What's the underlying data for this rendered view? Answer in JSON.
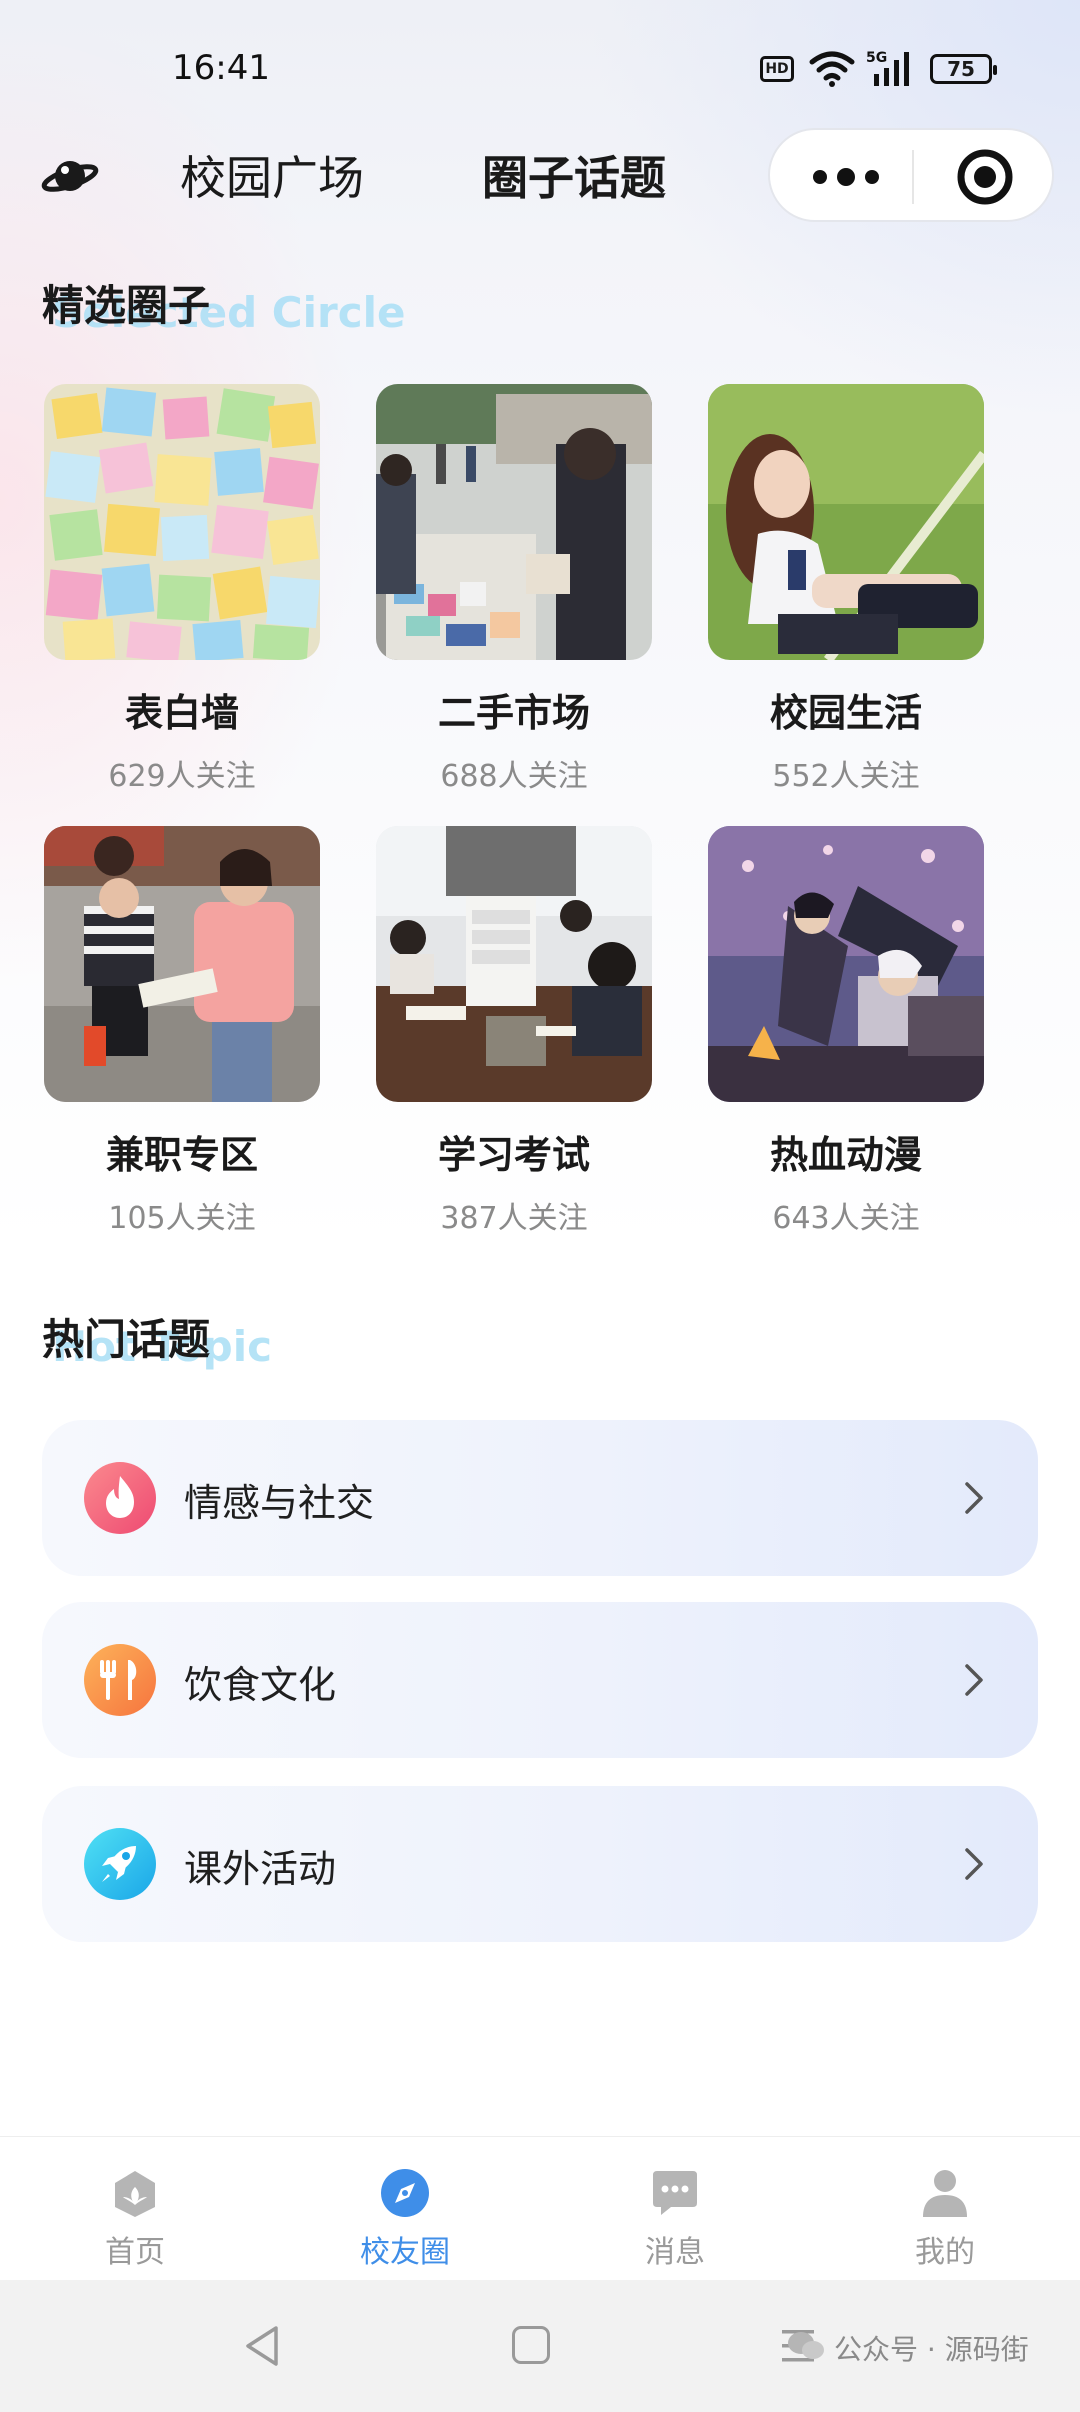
{
  "status_bar": {
    "time": "16:41",
    "hd": "HD",
    "network": "5G",
    "battery": "75"
  },
  "header": {
    "tabs": [
      {
        "label": "校园广场",
        "active": false
      },
      {
        "label": "圈子话题",
        "active": true
      }
    ],
    "capsule_icons": [
      "more-dots-icon",
      "target-icon"
    ]
  },
  "selected": {
    "title": "精选圈子",
    "subtitle": "Selected Circle",
    "items": [
      {
        "name": "表白墙",
        "followers": "629人关注"
      },
      {
        "name": "二手市场",
        "followers": "688人关注"
      },
      {
        "name": "校园生活",
        "followers": "552人关注"
      },
      {
        "name": "兼职专区",
        "followers": "105人关注"
      },
      {
        "name": "学习考试",
        "followers": "387人关注"
      },
      {
        "name": "热血动漫",
        "followers": "643人关注"
      }
    ]
  },
  "hot": {
    "title": "热门话题",
    "subtitle": "Hot Topic",
    "items": [
      {
        "label": "情感与社交",
        "icon": "flame-icon",
        "color": "#f0647f"
      },
      {
        "label": "饮食文化",
        "icon": "cutlery-icon",
        "color": "#f98f4a"
      },
      {
        "label": "课外活动",
        "icon": "rocket-icon",
        "color": "#2ec8ee"
      }
    ]
  },
  "tabbar": {
    "items": [
      {
        "label": "首页",
        "icon": "home-icon",
        "active": false
      },
      {
        "label": "校友圈",
        "icon": "compass-icon",
        "active": true
      },
      {
        "label": "消息",
        "icon": "message-icon",
        "active": false
      },
      {
        "label": "我的",
        "icon": "user-icon",
        "active": false
      }
    ],
    "active_color": "#3f8ee8",
    "inactive_color": "#9a9a9a"
  },
  "watermark": "公众号 · 源码街"
}
